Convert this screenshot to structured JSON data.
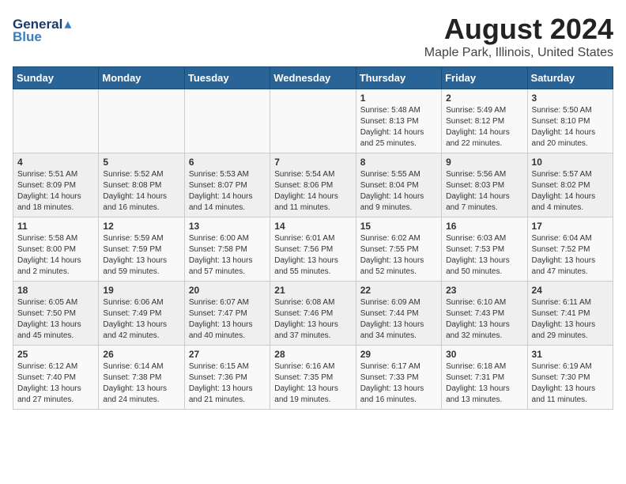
{
  "logo": {
    "general": "General",
    "blue": "Blue"
  },
  "header": {
    "title": "August 2024",
    "subtitle": "Maple Park, Illinois, United States"
  },
  "weekdays": [
    "Sunday",
    "Monday",
    "Tuesday",
    "Wednesday",
    "Thursday",
    "Friday",
    "Saturday"
  ],
  "weeks": [
    [
      {
        "day": "",
        "info": ""
      },
      {
        "day": "",
        "info": ""
      },
      {
        "day": "",
        "info": ""
      },
      {
        "day": "",
        "info": ""
      },
      {
        "day": "1",
        "info": "Sunrise: 5:48 AM\nSunset: 8:13 PM\nDaylight: 14 hours\nand 25 minutes."
      },
      {
        "day": "2",
        "info": "Sunrise: 5:49 AM\nSunset: 8:12 PM\nDaylight: 14 hours\nand 22 minutes."
      },
      {
        "day": "3",
        "info": "Sunrise: 5:50 AM\nSunset: 8:10 PM\nDaylight: 14 hours\nand 20 minutes."
      }
    ],
    [
      {
        "day": "4",
        "info": "Sunrise: 5:51 AM\nSunset: 8:09 PM\nDaylight: 14 hours\nand 18 minutes."
      },
      {
        "day": "5",
        "info": "Sunrise: 5:52 AM\nSunset: 8:08 PM\nDaylight: 14 hours\nand 16 minutes."
      },
      {
        "day": "6",
        "info": "Sunrise: 5:53 AM\nSunset: 8:07 PM\nDaylight: 14 hours\nand 14 minutes."
      },
      {
        "day": "7",
        "info": "Sunrise: 5:54 AM\nSunset: 8:06 PM\nDaylight: 14 hours\nand 11 minutes."
      },
      {
        "day": "8",
        "info": "Sunrise: 5:55 AM\nSunset: 8:04 PM\nDaylight: 14 hours\nand 9 minutes."
      },
      {
        "day": "9",
        "info": "Sunrise: 5:56 AM\nSunset: 8:03 PM\nDaylight: 14 hours\nand 7 minutes."
      },
      {
        "day": "10",
        "info": "Sunrise: 5:57 AM\nSunset: 8:02 PM\nDaylight: 14 hours\nand 4 minutes."
      }
    ],
    [
      {
        "day": "11",
        "info": "Sunrise: 5:58 AM\nSunset: 8:00 PM\nDaylight: 14 hours\nand 2 minutes."
      },
      {
        "day": "12",
        "info": "Sunrise: 5:59 AM\nSunset: 7:59 PM\nDaylight: 13 hours\nand 59 minutes."
      },
      {
        "day": "13",
        "info": "Sunrise: 6:00 AM\nSunset: 7:58 PM\nDaylight: 13 hours\nand 57 minutes."
      },
      {
        "day": "14",
        "info": "Sunrise: 6:01 AM\nSunset: 7:56 PM\nDaylight: 13 hours\nand 55 minutes."
      },
      {
        "day": "15",
        "info": "Sunrise: 6:02 AM\nSunset: 7:55 PM\nDaylight: 13 hours\nand 52 minutes."
      },
      {
        "day": "16",
        "info": "Sunrise: 6:03 AM\nSunset: 7:53 PM\nDaylight: 13 hours\nand 50 minutes."
      },
      {
        "day": "17",
        "info": "Sunrise: 6:04 AM\nSunset: 7:52 PM\nDaylight: 13 hours\nand 47 minutes."
      }
    ],
    [
      {
        "day": "18",
        "info": "Sunrise: 6:05 AM\nSunset: 7:50 PM\nDaylight: 13 hours\nand 45 minutes."
      },
      {
        "day": "19",
        "info": "Sunrise: 6:06 AM\nSunset: 7:49 PM\nDaylight: 13 hours\nand 42 minutes."
      },
      {
        "day": "20",
        "info": "Sunrise: 6:07 AM\nSunset: 7:47 PM\nDaylight: 13 hours\nand 40 minutes."
      },
      {
        "day": "21",
        "info": "Sunrise: 6:08 AM\nSunset: 7:46 PM\nDaylight: 13 hours\nand 37 minutes."
      },
      {
        "day": "22",
        "info": "Sunrise: 6:09 AM\nSunset: 7:44 PM\nDaylight: 13 hours\nand 34 minutes."
      },
      {
        "day": "23",
        "info": "Sunrise: 6:10 AM\nSunset: 7:43 PM\nDaylight: 13 hours\nand 32 minutes."
      },
      {
        "day": "24",
        "info": "Sunrise: 6:11 AM\nSunset: 7:41 PM\nDaylight: 13 hours\nand 29 minutes."
      }
    ],
    [
      {
        "day": "25",
        "info": "Sunrise: 6:12 AM\nSunset: 7:40 PM\nDaylight: 13 hours\nand 27 minutes."
      },
      {
        "day": "26",
        "info": "Sunrise: 6:14 AM\nSunset: 7:38 PM\nDaylight: 13 hours\nand 24 minutes."
      },
      {
        "day": "27",
        "info": "Sunrise: 6:15 AM\nSunset: 7:36 PM\nDaylight: 13 hours\nand 21 minutes."
      },
      {
        "day": "28",
        "info": "Sunrise: 6:16 AM\nSunset: 7:35 PM\nDaylight: 13 hours\nand 19 minutes."
      },
      {
        "day": "29",
        "info": "Sunrise: 6:17 AM\nSunset: 7:33 PM\nDaylight: 13 hours\nand 16 minutes."
      },
      {
        "day": "30",
        "info": "Sunrise: 6:18 AM\nSunset: 7:31 PM\nDaylight: 13 hours\nand 13 minutes."
      },
      {
        "day": "31",
        "info": "Sunrise: 6:19 AM\nSunset: 7:30 PM\nDaylight: 13 hours\nand 11 minutes."
      }
    ]
  ]
}
